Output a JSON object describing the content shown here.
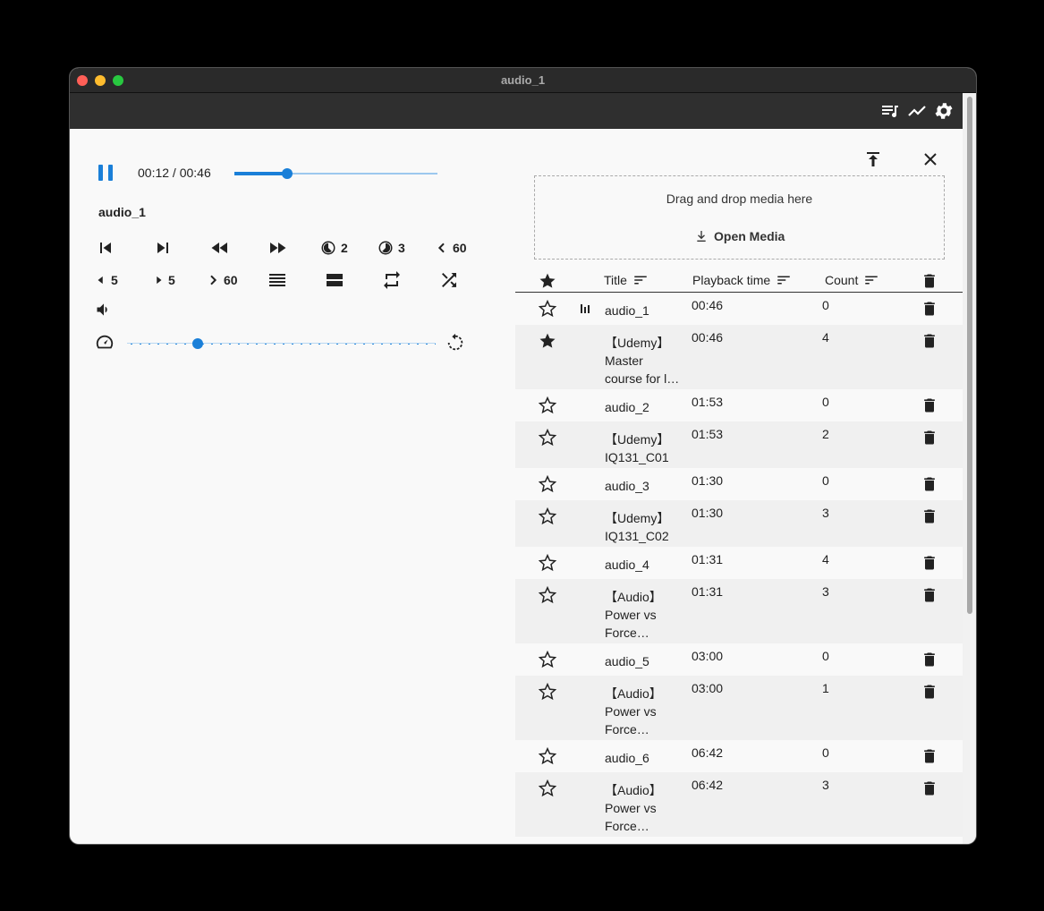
{
  "window": {
    "title": "audio_1"
  },
  "appbar": {
    "icons": [
      "playlist-icon",
      "trending-icon",
      "settings-icon"
    ]
  },
  "player": {
    "time": "00:12 / 00:46",
    "progress": 0.26,
    "track_name": "audio_1",
    "controls_row1": {
      "speed_a": "2",
      "speed_b": "3",
      "back_60": "60"
    },
    "controls_row2": {
      "back_5": "5",
      "fwd_5": "5",
      "fwd_60": "60"
    },
    "speed_level": 0.23
  },
  "dropzone": {
    "text": "Drag and drop media here",
    "open_label": "Open Media"
  },
  "table": {
    "headers": {
      "title": "Title",
      "playback_time": "Playback time",
      "count": "Count"
    },
    "rows": [
      {
        "starred": false,
        "playing": true,
        "title": "audio_1",
        "time": "00:46",
        "count": "0"
      },
      {
        "starred": true,
        "playing": false,
        "title": "【Udemy】 Master course for l…",
        "time": "00:46",
        "count": "4"
      },
      {
        "starred": false,
        "playing": false,
        "title": "audio_2",
        "time": "01:53",
        "count": "0"
      },
      {
        "starred": false,
        "playing": false,
        "title": "【Udemy】 IQ131_C01",
        "time": "01:53",
        "count": "2"
      },
      {
        "starred": false,
        "playing": false,
        "title": "audio_3",
        "time": "01:30",
        "count": "0"
      },
      {
        "starred": false,
        "playing": false,
        "title": "【Udemy】 IQ131_C02",
        "time": "01:30",
        "count": "3"
      },
      {
        "starred": false,
        "playing": false,
        "title": "audio_4",
        "time": "01:31",
        "count": "4"
      },
      {
        "starred": false,
        "playing": false,
        "title": "【Audio】 Power vs Force…",
        "time": "01:31",
        "count": "3"
      },
      {
        "starred": false,
        "playing": false,
        "title": "audio_5",
        "time": "03:00",
        "count": "0"
      },
      {
        "starred": false,
        "playing": false,
        "title": "【Audio】 Power vs Force…",
        "time": "03:00",
        "count": "1"
      },
      {
        "starred": false,
        "playing": false,
        "title": "audio_6",
        "time": "06:42",
        "count": "0"
      },
      {
        "starred": false,
        "playing": false,
        "title": "【Audio】 Power vs Force…",
        "time": "06:42",
        "count": "3"
      }
    ]
  },
  "colors": {
    "accent": "#1a7fd8",
    "titlebar": "#2a2a2a",
    "appbar": "#2f2f2f"
  }
}
